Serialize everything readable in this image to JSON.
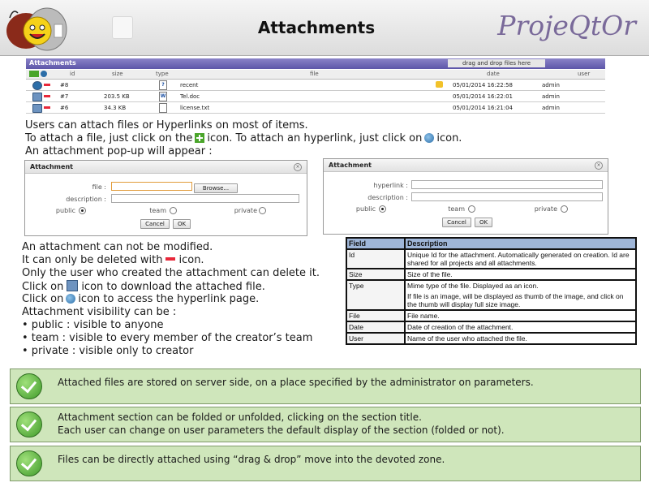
{
  "header": {
    "title": "Attachments",
    "brand": "ProjeQtOr"
  },
  "panel": {
    "section_title": "Attachments",
    "drop_zone_label": "drag and drop files here",
    "columns": [
      "id",
      "size",
      "type",
      "file",
      "date",
      "user"
    ],
    "rows": [
      {
        "id": "#8",
        "size": "",
        "type_icon": "link-icon",
        "file": "recent",
        "date": "05/01/2014 16:22:58",
        "user": "admin"
      },
      {
        "id": "#7",
        "size": "203.5 KB",
        "type_icon": "word-doc-icon",
        "file": "Tel.doc",
        "date": "05/01/2014 16:22:01",
        "user": "admin"
      },
      {
        "id": "#6",
        "size": "34.3 KB",
        "type_icon": "text-file-icon",
        "file": "license.txt",
        "date": "05/01/2014 16:21:04",
        "user": "admin"
      }
    ]
  },
  "intro": {
    "line1": "Users can attach files or Hyperlinks on most of items.",
    "line2_a": "To attach a file, just click on the",
    "line2_b": "icon. To attach an hyperlink, just click on",
    "line2_c": "icon.",
    "line3": "An attachment pop-up will appear :"
  },
  "dialog_file": {
    "title": "Attachment",
    "file_label": "file :",
    "browse": "Browse...",
    "description_label": "description :",
    "public": "public",
    "team": "team",
    "private": "private",
    "cancel": "Cancel",
    "ok": "OK"
  },
  "dialog_link": {
    "title": "Attachment",
    "hyperlink_label": "hyperlink :",
    "description_label": "description :",
    "public": "public",
    "team": "team",
    "private": "private",
    "cancel": "Cancel",
    "ok": "OK"
  },
  "rules": {
    "l1": "An attachment can not be modified.",
    "l2_a": "It can only be deleted with",
    "l2_b": "icon.",
    "l3": "Only the user who created the attachment can delete it.",
    "l4_a": "Click on",
    "l4_b": "icon to download the attached file.",
    "l5_a": "Click on",
    "l5_b": "icon to access the hyperlink page.",
    "l6": "Attachment visibility can be :",
    "l7": "• public : visible to anyone",
    "l8": "• team : visible to every member of the creator’s team",
    "l9": "• private : visible only to creator"
  },
  "fields_table": {
    "header": [
      "Field",
      "Description"
    ],
    "rows": [
      {
        "field": "Id",
        "desc": "Unique Id for the attachment. Automatically generated on creation. Id are shared for all projects and all attachments."
      },
      {
        "field": "Size",
        "desc": "Size of the file."
      },
      {
        "field": "Type",
        "desc": "Mime type of the file. Displayed as an icon.",
        "note": "If file is an image, will be displayed as thumb of the image, and click on the thumb will display full size image."
      },
      {
        "field": "File",
        "desc": "File name."
      },
      {
        "field": "Date",
        "desc": "Date of creation of the attachment."
      },
      {
        "field": "User",
        "desc": "Name of the user who attached the file."
      }
    ]
  },
  "tips": {
    "t1": "Attached files are stored on server side, on a place specified by the administrator on parameters.",
    "t2_a": "Attachment section can be folded or unfolded, clicking on the section title.",
    "t2_b": "Each user can change on user parameters the default display of the section (folded or not).",
    "t3": "Files can be directly attached using “drag & drop” move into the devoted zone."
  },
  "colors": {
    "panel_bar": "#5d56a8",
    "tip_bg": "#cfe6bb",
    "table_header": "#9fb6d8",
    "delete_red": "#e8283a",
    "add_green": "#4aa52a"
  }
}
